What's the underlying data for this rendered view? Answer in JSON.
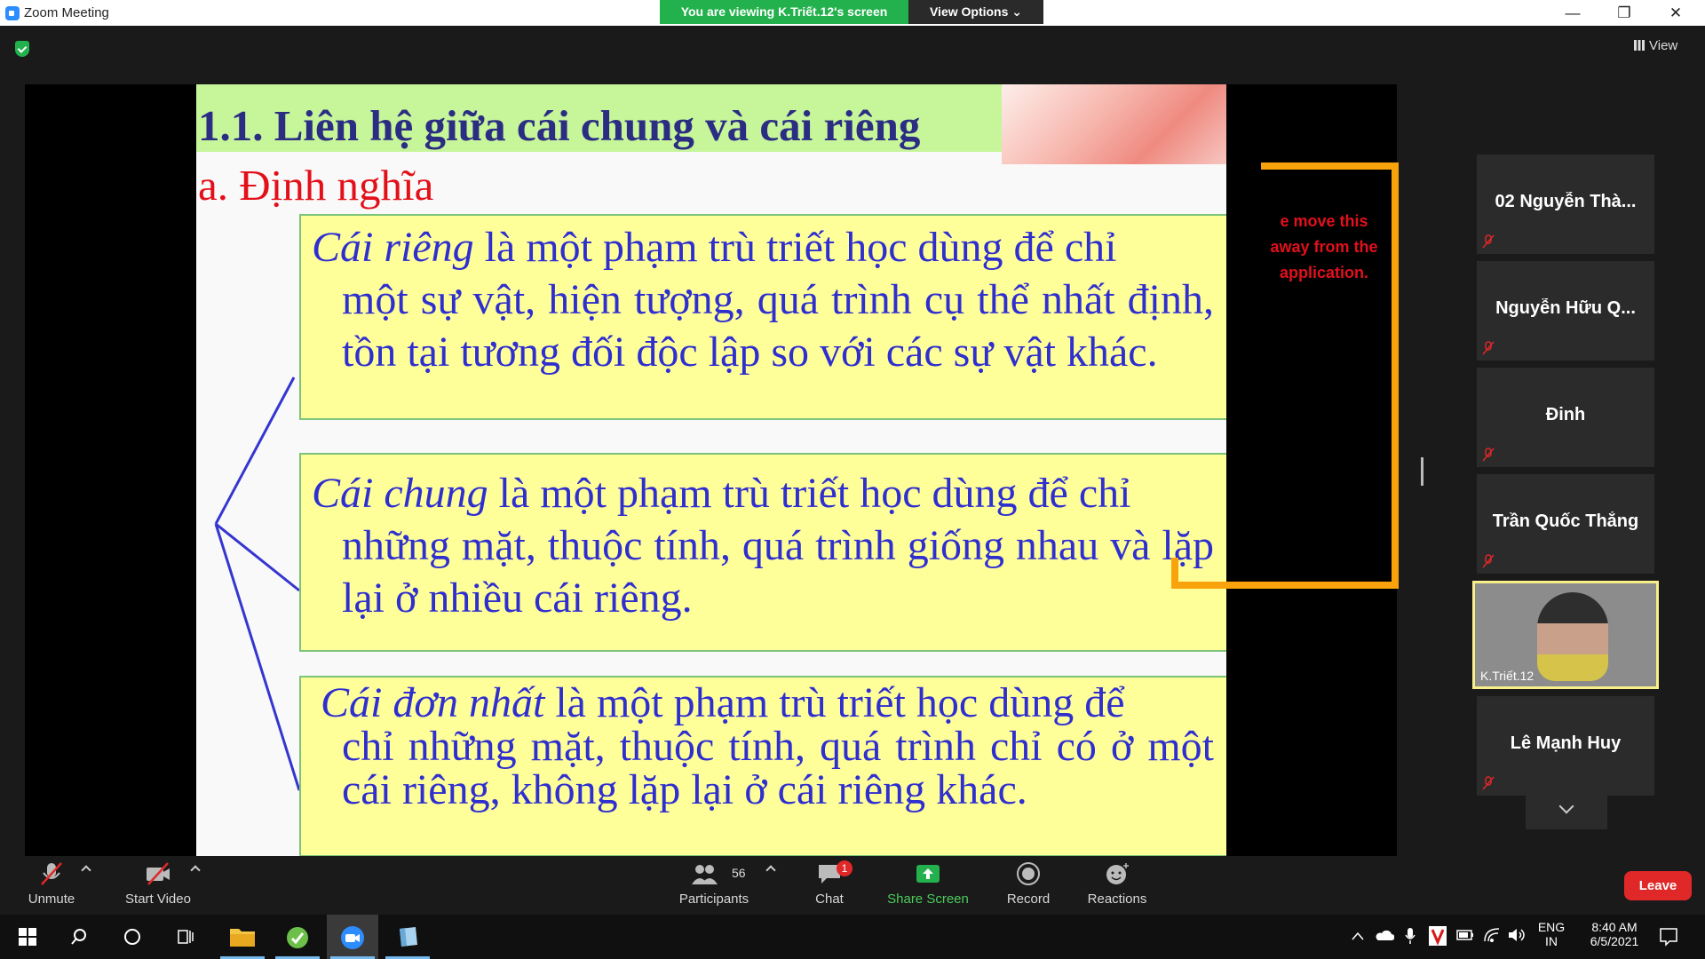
{
  "window": {
    "title": "Zoom Meeting",
    "viewing_banner": "You are viewing K.Triết.12's screen",
    "view_options": "View Options ⌄",
    "minimize": "—",
    "restore": "❐",
    "close": "✕"
  },
  "top_right": {
    "view_label": "View"
  },
  "slide": {
    "title": "1.1. Liên hệ giữa cái chung và cái riêng",
    "subtitle": "a. Định nghĩa",
    "def1_term": "Cái riêng",
    "def1_rest": " là một phạm trù triết học dùng để chỉ",
    "def1_lines": "một sự vật, hiện tượng, quá trình cụ thể nhất định, tồn tại tương đối độc lập so với các sự vật khác.",
    "def2_term": "Cái chung",
    "def2_rest": " là một phạm trù triết học dùng để chỉ",
    "def2_lines": "những mặt, thuộc tính, quá trình giống nhau và lặp lại ở nhiều cái riêng.",
    "def3_term": "Cái đơn nhất",
    "def3_rest": " là một phạm trù triết học dùng để",
    "def3_lines": "chỉ những mặt, thuộc tính, quá trình chỉ có ở một cái riêng, không lặp lại ở cái riêng khác."
  },
  "overlay": {
    "line1": "e move this",
    "line2": "away from the",
    "line3": "application."
  },
  "participants_panel": {
    "tiles": [
      {
        "name": "02 Nguyễn Thà..."
      },
      {
        "name": "Nguyễn Hữu Q..."
      },
      {
        "name": "Đinh"
      },
      {
        "name": "Trần Quốc Thắng"
      },
      {
        "name": "K.Triết.12",
        "video": true
      },
      {
        "name": "Lê Mạnh Huy"
      }
    ]
  },
  "toolbar": {
    "unmute": "Unmute",
    "start_video": "Start Video",
    "participants": "Participants",
    "participants_count": "56",
    "chat": "Chat",
    "chat_badge": "1",
    "share_screen": "Share Screen",
    "record": "Record",
    "reactions": "Reactions",
    "leave": "Leave"
  },
  "taskbar": {
    "language_top": "ENG",
    "language_bottom": "IN",
    "time": "8:40 AM",
    "date": "6/5/2021"
  },
  "colors": {
    "share_green": "#23b14d",
    "leave_red": "#e02828",
    "slide_title": "#2b2d83",
    "slide_subtitle": "#e3101a",
    "definition_text": "#2f2fcf",
    "box_fill": "#ffff9a",
    "frame_orange": "#f8a20c"
  }
}
